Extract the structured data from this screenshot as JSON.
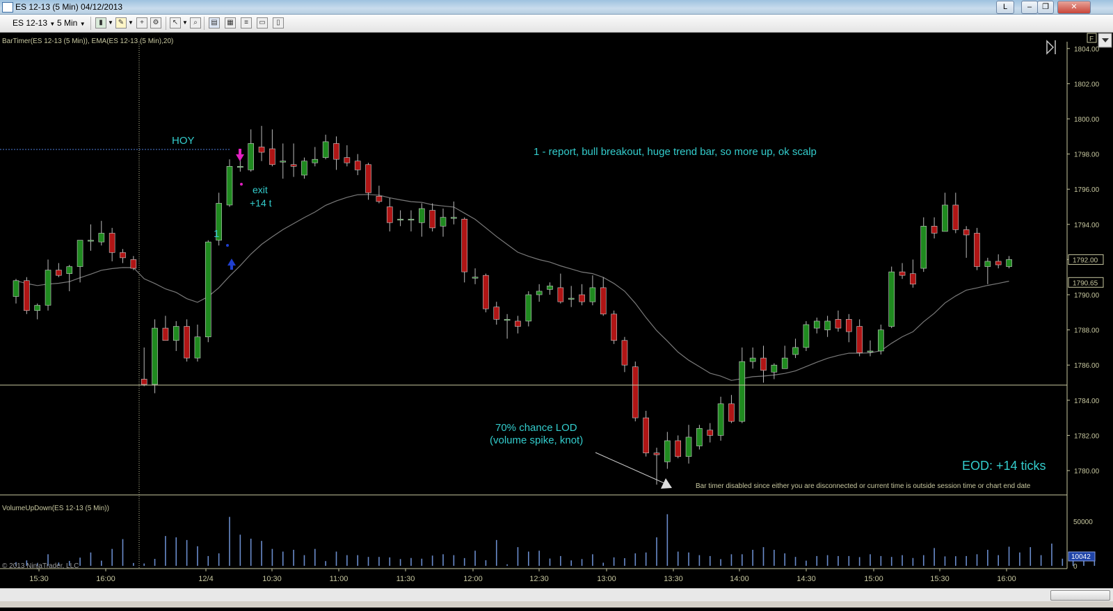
{
  "window": {
    "title": "ES 12-13 (5 Min)  04/12/2013",
    "controls": {
      "pin": "L",
      "minimize": "–",
      "restore": "❐",
      "close": "✕"
    }
  },
  "toolbar": {
    "instrument": "ES 12-13",
    "interval": "5 Min",
    "icons": [
      "bar-type-icon",
      "drawing-tool-icon",
      "indicator-icon",
      "strategy-icon",
      "pointer-icon",
      "zoom-icon",
      "chart-trader-icon",
      "data-box-icon",
      "properties-icon",
      "print-icon",
      "chart-template-icon"
    ]
  },
  "chart": {
    "indicator_label": "BarTimer(ES 12-13 (5 Min)), EMA(ES 12-13 (5 Min),20)",
    "volume_label": "VolumeUpDown(ES 12-13 (5 Min))",
    "copyright": "© 2013 NinjaTrader, LLC",
    "bar_timer_msg": "Bar timer disabled since either you are disconnected or current time is outside session time or chart end date",
    "f_button": "F",
    "price_ticks": [
      "1804.00",
      "1802.00",
      "1800.00",
      "1798.00",
      "1796.00",
      "1794.00",
      "1792.00",
      "1790.00",
      "1788.00",
      "1786.00",
      "1784.00",
      "1782.00",
      "1780.00"
    ],
    "price_badges": {
      "last_close": "1792.00",
      "ema": "1790.65"
    },
    "volume_ticks": [
      "50000",
      "0"
    ],
    "volume_badge": "10042",
    "time_ticks": [
      "15:30",
      "16:00",
      "12/4",
      "10:30",
      "11:00",
      "11:30",
      "12:00",
      "12:30",
      "13:00",
      "13:30",
      "14:00",
      "14:30",
      "15:00",
      "15:30",
      "16:00"
    ],
    "annotations": {
      "hoy": "HOY",
      "entry_num": "1",
      "exit_line1": "exit",
      "exit_line2": "+14 t",
      "note1": "1 - report, bull breakout, huge trend bar, so more up, ok scalp",
      "lod_line1": "70% chance LOD",
      "lod_line2": "(volume spike, knot)",
      "eod": "EOD: +14 ticks"
    },
    "colors": {
      "up": "#1f8a1f",
      "down": "#b01515",
      "text": "#33cccc",
      "axis": "#c8c8a0",
      "volume": "#6a8ccc",
      "ema": "#7a7a7a"
    }
  },
  "chart_data": {
    "type": "candlestick",
    "ylim": [
      1779,
      1805
    ],
    "bars": [
      {
        "t": "15:20",
        "o": 1789.9,
        "h": 1790.9,
        "l": 1789.5,
        "c": 1790.8
      },
      {
        "t": "15:25",
        "o": 1790.8,
        "h": 1791.0,
        "l": 1788.9,
        "c": 1789.1
      },
      {
        "t": "15:30",
        "o": 1789.1,
        "h": 1789.5,
        "l": 1788.6,
        "c": 1789.4
      },
      {
        "t": "15:35",
        "o": 1789.4,
        "h": 1792.0,
        "l": 1789.1,
        "c": 1791.4
      },
      {
        "t": "15:40",
        "o": 1791.4,
        "h": 1791.8,
        "l": 1791.0,
        "c": 1791.1
      },
      {
        "t": "15:45",
        "o": 1791.2,
        "h": 1791.7,
        "l": 1790.2,
        "c": 1791.6
      },
      {
        "t": "15:50",
        "o": 1791.6,
        "h": 1792.7,
        "l": 1790.7,
        "c": 1793.1
      },
      {
        "t": "15:55",
        "o": 1793.1,
        "h": 1794.0,
        "l": 1792.5,
        "c": 1793.1
      },
      {
        "t": "16:00",
        "o": 1793.0,
        "h": 1794.2,
        "l": 1792.8,
        "c": 1793.5
      },
      {
        "t": "16:05",
        "o": 1793.5,
        "h": 1793.8,
        "l": 1791.9,
        "c": 1792.4
      },
      {
        "t": "16:10",
        "o": 1792.4,
        "h": 1792.6,
        "l": 1791.8,
        "c": 1792.1
      },
      {
        "t": "16:15",
        "o": 1792.0,
        "h": 1792.2,
        "l": 1791.4,
        "c": 1791.5
      },
      {
        "t": "09:30",
        "o": 1785.2,
        "h": 1787.0,
        "l": 1784.8,
        "c": 1784.9
      },
      {
        "t": "09:35",
        "o": 1784.9,
        "h": 1788.6,
        "l": 1784.4,
        "c": 1788.1
      },
      {
        "t": "09:40",
        "o": 1788.1,
        "h": 1788.8,
        "l": 1787.4,
        "c": 1787.4
      },
      {
        "t": "09:45",
        "o": 1787.4,
        "h": 1788.5,
        "l": 1786.8,
        "c": 1788.2
      },
      {
        "t": "09:50",
        "o": 1788.2,
        "h": 1788.6,
        "l": 1786.2,
        "c": 1786.4
      },
      {
        "t": "09:55",
        "o": 1786.4,
        "h": 1788.3,
        "l": 1786.2,
        "c": 1787.6
      },
      {
        "t": "10:00",
        "o": 1787.6,
        "h": 1793.1,
        "l": 1787.3,
        "c": 1793.0
      },
      {
        "t": "10:05",
        "o": 1793.1,
        "h": 1795.8,
        "l": 1792.8,
        "c": 1795.2
      },
      {
        "t": "10:10",
        "o": 1795.1,
        "h": 1797.7,
        "l": 1795.0,
        "c": 1797.3
      },
      {
        "t": "10:15",
        "o": 1797.3,
        "h": 1798.1,
        "l": 1797.0,
        "c": 1797.3
      },
      {
        "t": "10:20",
        "o": 1797.1,
        "h": 1799.4,
        "l": 1797.0,
        "c": 1798.6
      },
      {
        "t": "10:25",
        "o": 1798.4,
        "h": 1799.6,
        "l": 1797.6,
        "c": 1798.1
      },
      {
        "t": "10:30",
        "o": 1798.3,
        "h": 1799.4,
        "l": 1797.3,
        "c": 1797.4
      },
      {
        "t": "10:35",
        "o": 1797.6,
        "h": 1798.6,
        "l": 1796.6,
        "c": 1797.6
      },
      {
        "t": "10:40",
        "o": 1797.4,
        "h": 1798.6,
        "l": 1796.7,
        "c": 1797.3
      },
      {
        "t": "10:45",
        "o": 1796.8,
        "h": 1797.8,
        "l": 1796.6,
        "c": 1797.6
      },
      {
        "t": "10:50",
        "o": 1797.5,
        "h": 1798.4,
        "l": 1797.3,
        "c": 1797.7
      },
      {
        "t": "10:55",
        "o": 1797.8,
        "h": 1799.1,
        "l": 1797.7,
        "c": 1798.7
      },
      {
        "t": "11:00",
        "o": 1798.6,
        "h": 1799.0,
        "l": 1797.1,
        "c": 1797.7
      },
      {
        "t": "11:05",
        "o": 1797.8,
        "h": 1798.5,
        "l": 1797.3,
        "c": 1797.5
      },
      {
        "t": "11:10",
        "o": 1797.6,
        "h": 1798.0,
        "l": 1796.8,
        "c": 1797.1
      },
      {
        "t": "11:15",
        "o": 1797.4,
        "h": 1797.5,
        "l": 1795.4,
        "c": 1795.8
      },
      {
        "t": "11:20",
        "o": 1795.6,
        "h": 1796.2,
        "l": 1795.2,
        "c": 1795.3
      },
      {
        "t": "11:25",
        "o": 1795.0,
        "h": 1795.5,
        "l": 1793.6,
        "c": 1794.1
      },
      {
        "t": "11:30",
        "o": 1794.3,
        "h": 1794.8,
        "l": 1793.9,
        "c": 1794.3
      },
      {
        "t": "11:35",
        "o": 1794.3,
        "h": 1794.8,
        "l": 1793.6,
        "c": 1794.3
      },
      {
        "t": "11:40",
        "o": 1794.1,
        "h": 1795.2,
        "l": 1793.3,
        "c": 1794.9
      },
      {
        "t": "11:45",
        "o": 1794.8,
        "h": 1795.2,
        "l": 1793.6,
        "c": 1793.8
      },
      {
        "t": "11:50",
        "o": 1793.9,
        "h": 1794.9,
        "l": 1793.3,
        "c": 1794.4
      },
      {
        "t": "11:55",
        "o": 1794.4,
        "h": 1795.3,
        "l": 1794.0,
        "c": 1794.4
      },
      {
        "t": "12:00",
        "o": 1794.3,
        "h": 1794.4,
        "l": 1790.7,
        "c": 1791.3
      },
      {
        "t": "12:05",
        "o": 1791.0,
        "h": 1791.5,
        "l": 1790.6,
        "c": 1791.0
      },
      {
        "t": "12:10",
        "o": 1791.1,
        "h": 1791.2,
        "l": 1789.0,
        "c": 1789.2
      },
      {
        "t": "12:15",
        "o": 1789.3,
        "h": 1789.6,
        "l": 1788.3,
        "c": 1788.6
      },
      {
        "t": "12:20",
        "o": 1788.6,
        "h": 1788.9,
        "l": 1787.5,
        "c": 1788.6
      },
      {
        "t": "12:25",
        "o": 1788.5,
        "h": 1788.8,
        "l": 1787.8,
        "c": 1788.2
      },
      {
        "t": "12:30",
        "o": 1788.5,
        "h": 1790.2,
        "l": 1788.2,
        "c": 1790.0
      },
      {
        "t": "12:35",
        "o": 1790.0,
        "h": 1790.6,
        "l": 1789.6,
        "c": 1790.2
      },
      {
        "t": "12:40",
        "o": 1790.3,
        "h": 1790.7,
        "l": 1790.0,
        "c": 1790.5
      },
      {
        "t": "12:45",
        "o": 1790.4,
        "h": 1791.2,
        "l": 1789.5,
        "c": 1789.6
      },
      {
        "t": "12:50",
        "o": 1789.8,
        "h": 1790.5,
        "l": 1789.3,
        "c": 1789.8
      },
      {
        "t": "12:55",
        "o": 1790.0,
        "h": 1790.6,
        "l": 1789.4,
        "c": 1789.6
      },
      {
        "t": "13:00",
        "o": 1789.6,
        "h": 1791.1,
        "l": 1789.4,
        "c": 1790.4
      },
      {
        "t": "13:05",
        "o": 1790.4,
        "h": 1791.0,
        "l": 1788.8,
        "c": 1788.9
      },
      {
        "t": "13:10",
        "o": 1788.9,
        "h": 1789.1,
        "l": 1787.2,
        "c": 1787.4
      },
      {
        "t": "13:15",
        "o": 1787.4,
        "h": 1787.6,
        "l": 1785.6,
        "c": 1786.0
      },
      {
        "t": "13:20",
        "o": 1785.9,
        "h": 1786.2,
        "l": 1782.8,
        "c": 1783.0
      },
      {
        "t": "13:25",
        "o": 1783.0,
        "h": 1783.4,
        "l": 1780.8,
        "c": 1781.0
      },
      {
        "t": "13:30",
        "o": 1781.0,
        "h": 1781.3,
        "l": 1779.2,
        "c": 1780.9
      },
      {
        "t": "13:35",
        "o": 1780.5,
        "h": 1782.2,
        "l": 1780.1,
        "c": 1781.7
      },
      {
        "t": "13:40",
        "o": 1781.7,
        "h": 1782.0,
        "l": 1780.7,
        "c": 1780.8
      },
      {
        "t": "13:45",
        "o": 1780.8,
        "h": 1782.6,
        "l": 1780.4,
        "c": 1781.9
      },
      {
        "t": "13:50",
        "o": 1781.4,
        "h": 1782.6,
        "l": 1781.2,
        "c": 1782.4
      },
      {
        "t": "13:55",
        "o": 1782.3,
        "h": 1782.7,
        "l": 1781.6,
        "c": 1782.0
      },
      {
        "t": "14:00",
        "o": 1782.0,
        "h": 1784.2,
        "l": 1781.7,
        "c": 1783.8
      },
      {
        "t": "14:05",
        "o": 1783.8,
        "h": 1784.3,
        "l": 1782.7,
        "c": 1782.8
      },
      {
        "t": "14:10",
        "o": 1782.8,
        "h": 1787.0,
        "l": 1782.7,
        "c": 1786.2
      },
      {
        "t": "14:15",
        "o": 1786.2,
        "h": 1787.0,
        "l": 1785.8,
        "c": 1786.4
      },
      {
        "t": "14:20",
        "o": 1786.4,
        "h": 1787.1,
        "l": 1785.0,
        "c": 1785.7
      },
      {
        "t": "14:25",
        "o": 1785.6,
        "h": 1786.1,
        "l": 1785.2,
        "c": 1786.0
      },
      {
        "t": "14:30",
        "o": 1785.8,
        "h": 1787.1,
        "l": 1785.8,
        "c": 1786.4
      },
      {
        "t": "14:35",
        "o": 1786.6,
        "h": 1787.5,
        "l": 1786.4,
        "c": 1787.0
      },
      {
        "t": "14:40",
        "o": 1787.0,
        "h": 1788.5,
        "l": 1786.8,
        "c": 1788.3
      },
      {
        "t": "14:45",
        "o": 1788.1,
        "h": 1788.7,
        "l": 1787.8,
        "c": 1788.5
      },
      {
        "t": "14:50",
        "o": 1788.0,
        "h": 1788.8,
        "l": 1787.6,
        "c": 1788.5
      },
      {
        "t": "14:55",
        "o": 1788.6,
        "h": 1789.1,
        "l": 1787.9,
        "c": 1788.1
      },
      {
        "t": "15:00",
        "o": 1788.6,
        "h": 1788.9,
        "l": 1787.3,
        "c": 1787.9
      },
      {
        "t": "15:05",
        "o": 1788.2,
        "h": 1788.6,
        "l": 1786.5,
        "c": 1786.7
      },
      {
        "t": "15:10",
        "o": 1786.8,
        "h": 1787.4,
        "l": 1786.5,
        "c": 1786.8
      },
      {
        "t": "15:15",
        "o": 1786.8,
        "h": 1788.3,
        "l": 1786.6,
        "c": 1788.0
      },
      {
        "t": "15:20",
        "o": 1788.2,
        "h": 1791.6,
        "l": 1788.1,
        "c": 1791.3
      },
      {
        "t": "15:25",
        "o": 1791.3,
        "h": 1791.8,
        "l": 1790.9,
        "c": 1791.1
      },
      {
        "t": "15:30",
        "o": 1791.2,
        "h": 1792.0,
        "l": 1790.4,
        "c": 1790.6
      },
      {
        "t": "15:35",
        "o": 1791.5,
        "h": 1794.4,
        "l": 1791.3,
        "c": 1793.9
      },
      {
        "t": "15:40",
        "o": 1793.9,
        "h": 1794.4,
        "l": 1793.2,
        "c": 1793.5
      },
      {
        "t": "15:45",
        "o": 1793.6,
        "h": 1795.8,
        "l": 1793.6,
        "c": 1795.1
      },
      {
        "t": "15:50",
        "o": 1795.1,
        "h": 1795.8,
        "l": 1793.5,
        "c": 1793.7
      },
      {
        "t": "15:55",
        "o": 1793.7,
        "h": 1793.9,
        "l": 1792.1,
        "c": 1793.4
      },
      {
        "t": "16:00",
        "o": 1793.5,
        "h": 1793.8,
        "l": 1791.4,
        "c": 1791.6
      },
      {
        "t": "16:05",
        "o": 1791.6,
        "h": 1792.1,
        "l": 1790.6,
        "c": 1791.9
      },
      {
        "t": "16:10",
        "o": 1791.9,
        "h": 1792.3,
        "l": 1791.5,
        "c": 1791.7
      },
      {
        "t": "16:15",
        "o": 1791.6,
        "h": 1792.2,
        "l": 1791.5,
        "c": 1792.0
      }
    ],
    "volume": [
      4100,
      6100,
      2900,
      13000,
      3700,
      5500,
      9200,
      15000,
      5800,
      19000,
      30000,
      3200,
      2600,
      7800,
      33500,
      32000,
      29000,
      22000,
      11000,
      14000,
      55000,
      35000,
      30500,
      28000,
      19000,
      16000,
      18000,
      12000,
      19000,
      5300,
      16000,
      12000,
      12000,
      10000,
      10000,
      9500,
      7600,
      8800,
      8000,
      11500,
      13000,
      12000,
      8700,
      17000,
      6300,
      29000,
      1700,
      21000,
      16000,
      17000,
      8200,
      11000,
      6100,
      7600,
      13000,
      3500,
      9500,
      8600,
      14000,
      15000,
      32000,
      58000,
      16000,
      15000,
      12000,
      11000,
      7500,
      13000,
      13000,
      18000,
      21000,
      18000,
      14000,
      10000,
      5800,
      11000,
      12000,
      11000,
      11000,
      9800,
      13000,
      11000,
      10000,
      12000,
      8800,
      12000,
      20000,
      10600,
      10800,
      11000,
      13000,
      18000,
      12000,
      21500,
      15000,
      21000,
      12000,
      25000,
      8000,
      5400,
      6100,
      11000
    ]
  }
}
